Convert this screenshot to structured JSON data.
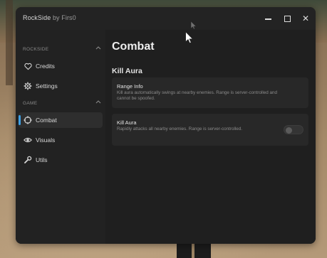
{
  "window": {
    "app_name": "RockSide",
    "by_text": "by Firs0",
    "controls": {
      "minimize": "minimize",
      "maximize": "maximize",
      "close": "✕"
    }
  },
  "sidebar": {
    "sections": [
      {
        "label": "ROCKSIDE",
        "items": [
          {
            "label": "Credits",
            "icon": "heart-icon",
            "active": false
          },
          {
            "label": "Settings",
            "icon": "gear-icon",
            "active": false
          }
        ]
      },
      {
        "label": "GAME",
        "items": [
          {
            "label": "Combat",
            "icon": "crosshair-icon",
            "active": true
          },
          {
            "label": "Visuals",
            "icon": "eye-icon",
            "active": false
          },
          {
            "label": "Utils",
            "icon": "wrench-icon",
            "active": false
          }
        ]
      }
    ]
  },
  "main": {
    "title": "Combat",
    "section": "Kill Aura",
    "cards": [
      {
        "title": "Range Info",
        "description": "Kill aura automatically swings at nearby enemies. Range is server-controlled and cannot be spoofed."
      },
      {
        "title": "Kill Aura",
        "description": "Rapidly attacks all nearby enemies. Range is server-controlled.",
        "toggle": {
          "enabled": false
        }
      }
    ]
  },
  "colors": {
    "accent": "#3fa1e6",
    "window_bg": "#1f1f1f",
    "sidebar_bg": "#222222",
    "card_bg": "#282828"
  }
}
